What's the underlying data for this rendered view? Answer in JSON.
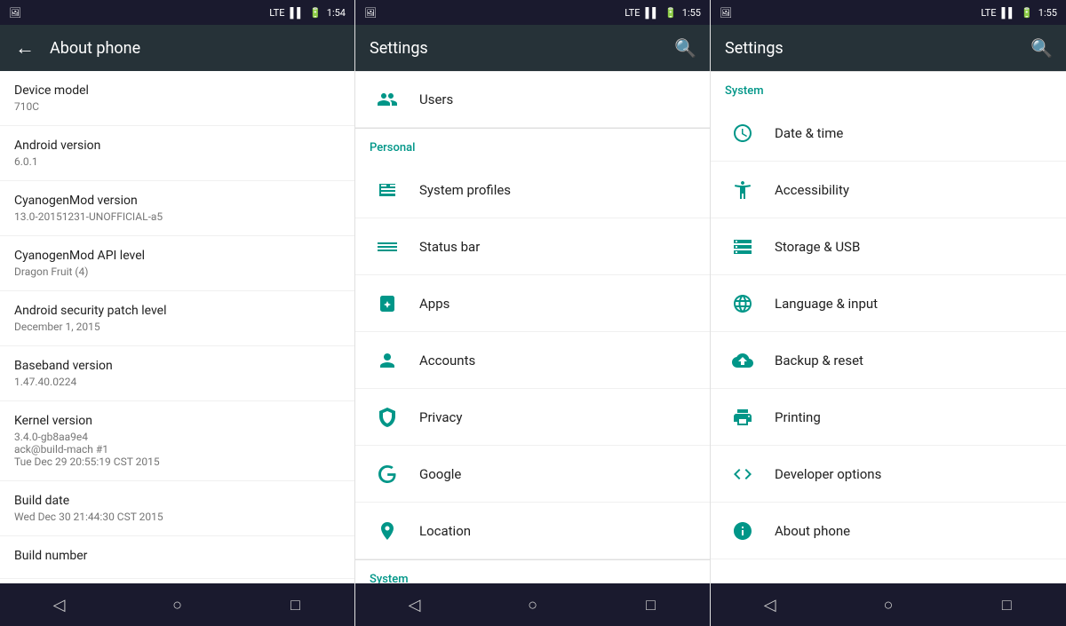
{
  "panels": [
    {
      "id": "about-phone",
      "statusBar": {
        "leftIcon": "🖼",
        "signal": "LTE",
        "time": "1:54"
      },
      "toolbar": {
        "hasBack": true,
        "title": "About phone",
        "hasSearch": false
      },
      "items": [
        {
          "label": "Device model",
          "value": "710C"
        },
        {
          "label": "Android version",
          "value": "6.0.1"
        },
        {
          "label": "CyanogenMod version",
          "value": "13.0-20151231-UNOFFICIAL-a5"
        },
        {
          "label": "CyanogenMod API level",
          "value": "Dragon Fruit (4)"
        },
        {
          "label": "Android security patch level",
          "value": "December 1, 2015"
        },
        {
          "label": "Baseband version",
          "value": "1.47.40.0224"
        },
        {
          "label": "Kernel version",
          "value": "3.4.0-gb8aa9e4\nack@build-mach #1\nTue Dec 29 20:55:19 CST 2015"
        },
        {
          "label": "Build date",
          "value": "Wed Dec 30 21:44:30 CST 2015"
        },
        {
          "label": "Build number",
          "value": ""
        }
      ]
    },
    {
      "id": "settings-personal",
      "statusBar": {
        "leftIcon": "🖼",
        "signal": "LTE",
        "time": "1:55"
      },
      "toolbar": {
        "hasBack": false,
        "title": "Settings",
        "hasSearch": true
      },
      "scrolledItem": "Users",
      "sections": [
        {
          "header": "Personal",
          "items": [
            {
              "id": "system-profiles",
              "label": "System profiles",
              "icon": "profiles"
            },
            {
              "id": "status-bar",
              "label": "Status bar",
              "icon": "statusbar"
            },
            {
              "id": "apps",
              "label": "Apps",
              "icon": "apps"
            },
            {
              "id": "accounts",
              "label": "Accounts",
              "icon": "accounts"
            },
            {
              "id": "privacy",
              "label": "Privacy",
              "icon": "privacy"
            },
            {
              "id": "google",
              "label": "Google",
              "icon": "google"
            },
            {
              "id": "location",
              "label": "Location",
              "icon": "location"
            }
          ]
        },
        {
          "header": "System",
          "items": []
        }
      ]
    },
    {
      "id": "settings-system",
      "statusBar": {
        "leftIcon": "🖼",
        "signal": "LTE",
        "time": "1:55"
      },
      "toolbar": {
        "hasBack": false,
        "title": "Settings",
        "hasSearch": true
      },
      "sections": [
        {
          "header": "System",
          "items": [
            {
              "id": "date-time",
              "label": "Date & time",
              "icon": "datetime"
            },
            {
              "id": "accessibility",
              "label": "Accessibility",
              "icon": "accessibility"
            },
            {
              "id": "storage-usb",
              "label": "Storage & USB",
              "icon": "storage"
            },
            {
              "id": "language-input",
              "label": "Language & input",
              "icon": "language"
            },
            {
              "id": "backup-reset",
              "label": "Backup & reset",
              "icon": "backup"
            },
            {
              "id": "printing",
              "label": "Printing",
              "icon": "printing"
            },
            {
              "id": "developer-options",
              "label": "Developer options",
              "icon": "developer"
            },
            {
              "id": "about-phone",
              "label": "About phone",
              "icon": "aboutphone"
            }
          ]
        }
      ]
    }
  ],
  "nav": {
    "back": "◁",
    "home": "○",
    "recents": "□"
  }
}
